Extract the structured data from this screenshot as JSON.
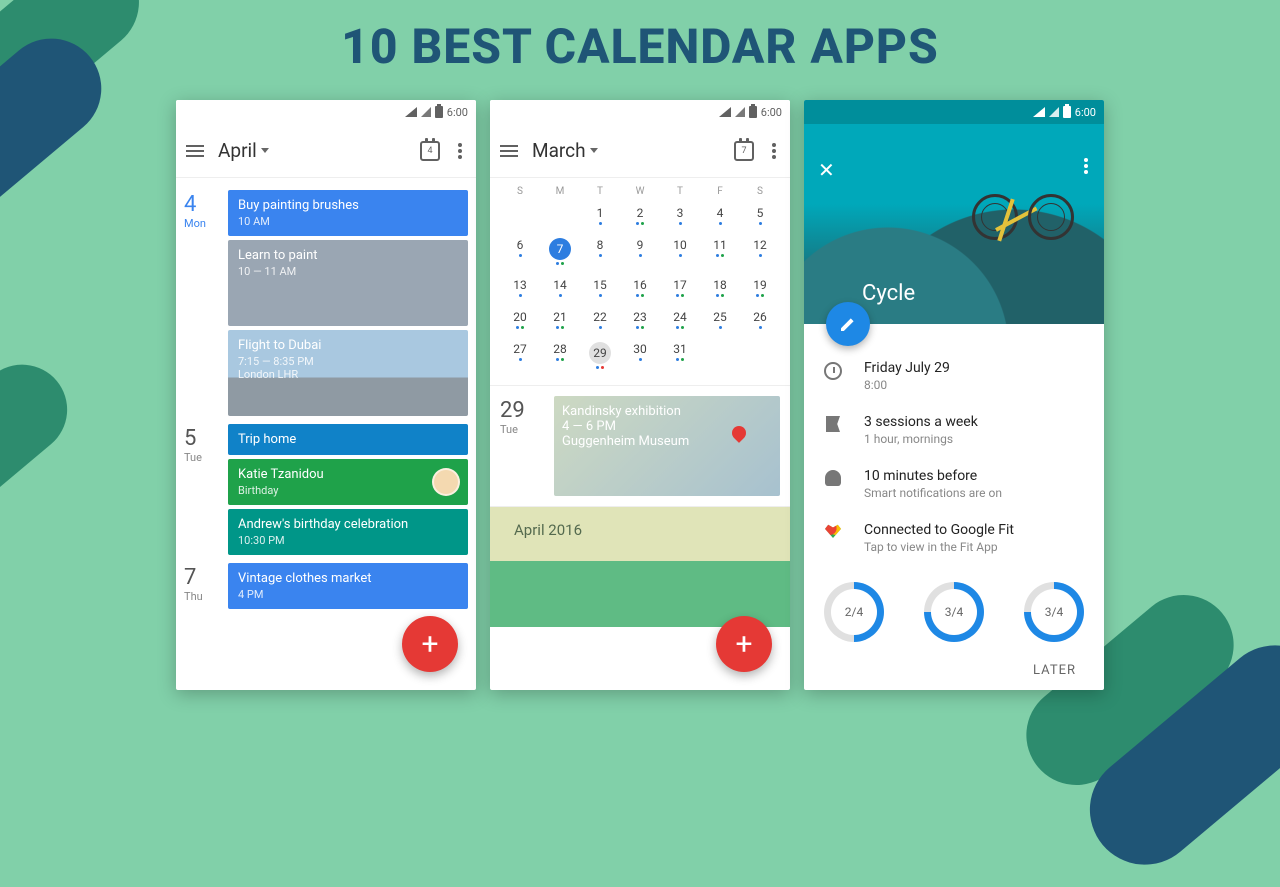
{
  "headline": "10 BEST CALENDAR APPS",
  "status_time": "6:00",
  "phone1": {
    "month": "April",
    "today_badge": "4",
    "days": [
      {
        "num": "4",
        "label": "Mon",
        "current": true,
        "events": [
          {
            "kind": "blue",
            "title": "Buy painting brushes",
            "sub": "10 AM",
            "bg": "#3a84ef"
          },
          {
            "kind": "image",
            "title": "Learn to paint",
            "sub": "10 — 11 AM"
          },
          {
            "kind": "sky",
            "title": "Flight to Dubai",
            "sub": "7:15 — 8:35 PM\nLondon LHR"
          }
        ]
      },
      {
        "num": "5",
        "label": "Tue",
        "current": false,
        "events": [
          {
            "kind": "blue",
            "title": "Trip home",
            "sub": "",
            "bg": "#1082c8"
          },
          {
            "kind": "green",
            "title": "Katie Tzanidou",
            "sub": "Birthday",
            "bg": "#1fa24a",
            "avatar": true
          },
          {
            "kind": "teal",
            "title": "Andrew's birthday celebration",
            "sub": "10:30 PM",
            "bg": "#009688"
          }
        ]
      },
      {
        "num": "7",
        "label": "Thu",
        "current": false,
        "events": [
          {
            "kind": "blue",
            "title": "Vintage clothes market",
            "sub": "4 PM",
            "bg": "#3a84ef"
          }
        ]
      }
    ]
  },
  "phone2": {
    "month": "March",
    "today_badge": "7",
    "dow": [
      "S",
      "M",
      "T",
      "W",
      "T",
      "F",
      "S"
    ],
    "weeks": [
      [
        "",
        "",
        "1",
        "2",
        "3",
        "4",
        "5"
      ],
      [
        "6",
        "7",
        "8",
        "9",
        "10",
        "11",
        "12"
      ],
      [
        "13",
        "14",
        "15",
        "16",
        "17",
        "18",
        "19"
      ],
      [
        "20",
        "21",
        "22",
        "23",
        "24",
        "25",
        "26"
      ],
      [
        "27",
        "28",
        "29",
        "30",
        "31",
        "",
        ""
      ]
    ],
    "selected": "7",
    "today": "29",
    "agenda_day_num": "29",
    "agenda_day_lbl": "Tue",
    "agenda_title": "Kandinsky exhibition",
    "agenda_sub": "4 — 6 PM",
    "agenda_loc": "Guggenheim Museum",
    "month_header": "April 2016"
  },
  "phone3": {
    "title": "Cycle",
    "rows": [
      {
        "t1": "Friday July 29",
        "t2": "8:00",
        "icon": "clock"
      },
      {
        "t1": "3 sessions a week",
        "t2": "1 hour, mornings",
        "icon": "flag"
      },
      {
        "t1": "10 minutes before",
        "t2": "Smart notifications are on",
        "icon": "bell"
      },
      {
        "t1": "Connected to Google Fit",
        "t2": "Tap to view in the Fit App",
        "icon": "heart"
      }
    ],
    "progress": [
      {
        "label": "2/4",
        "pct": 50
      },
      {
        "label": "3/4",
        "pct": 75
      },
      {
        "label": "3/4",
        "pct": 75
      }
    ],
    "later": "LATER"
  }
}
